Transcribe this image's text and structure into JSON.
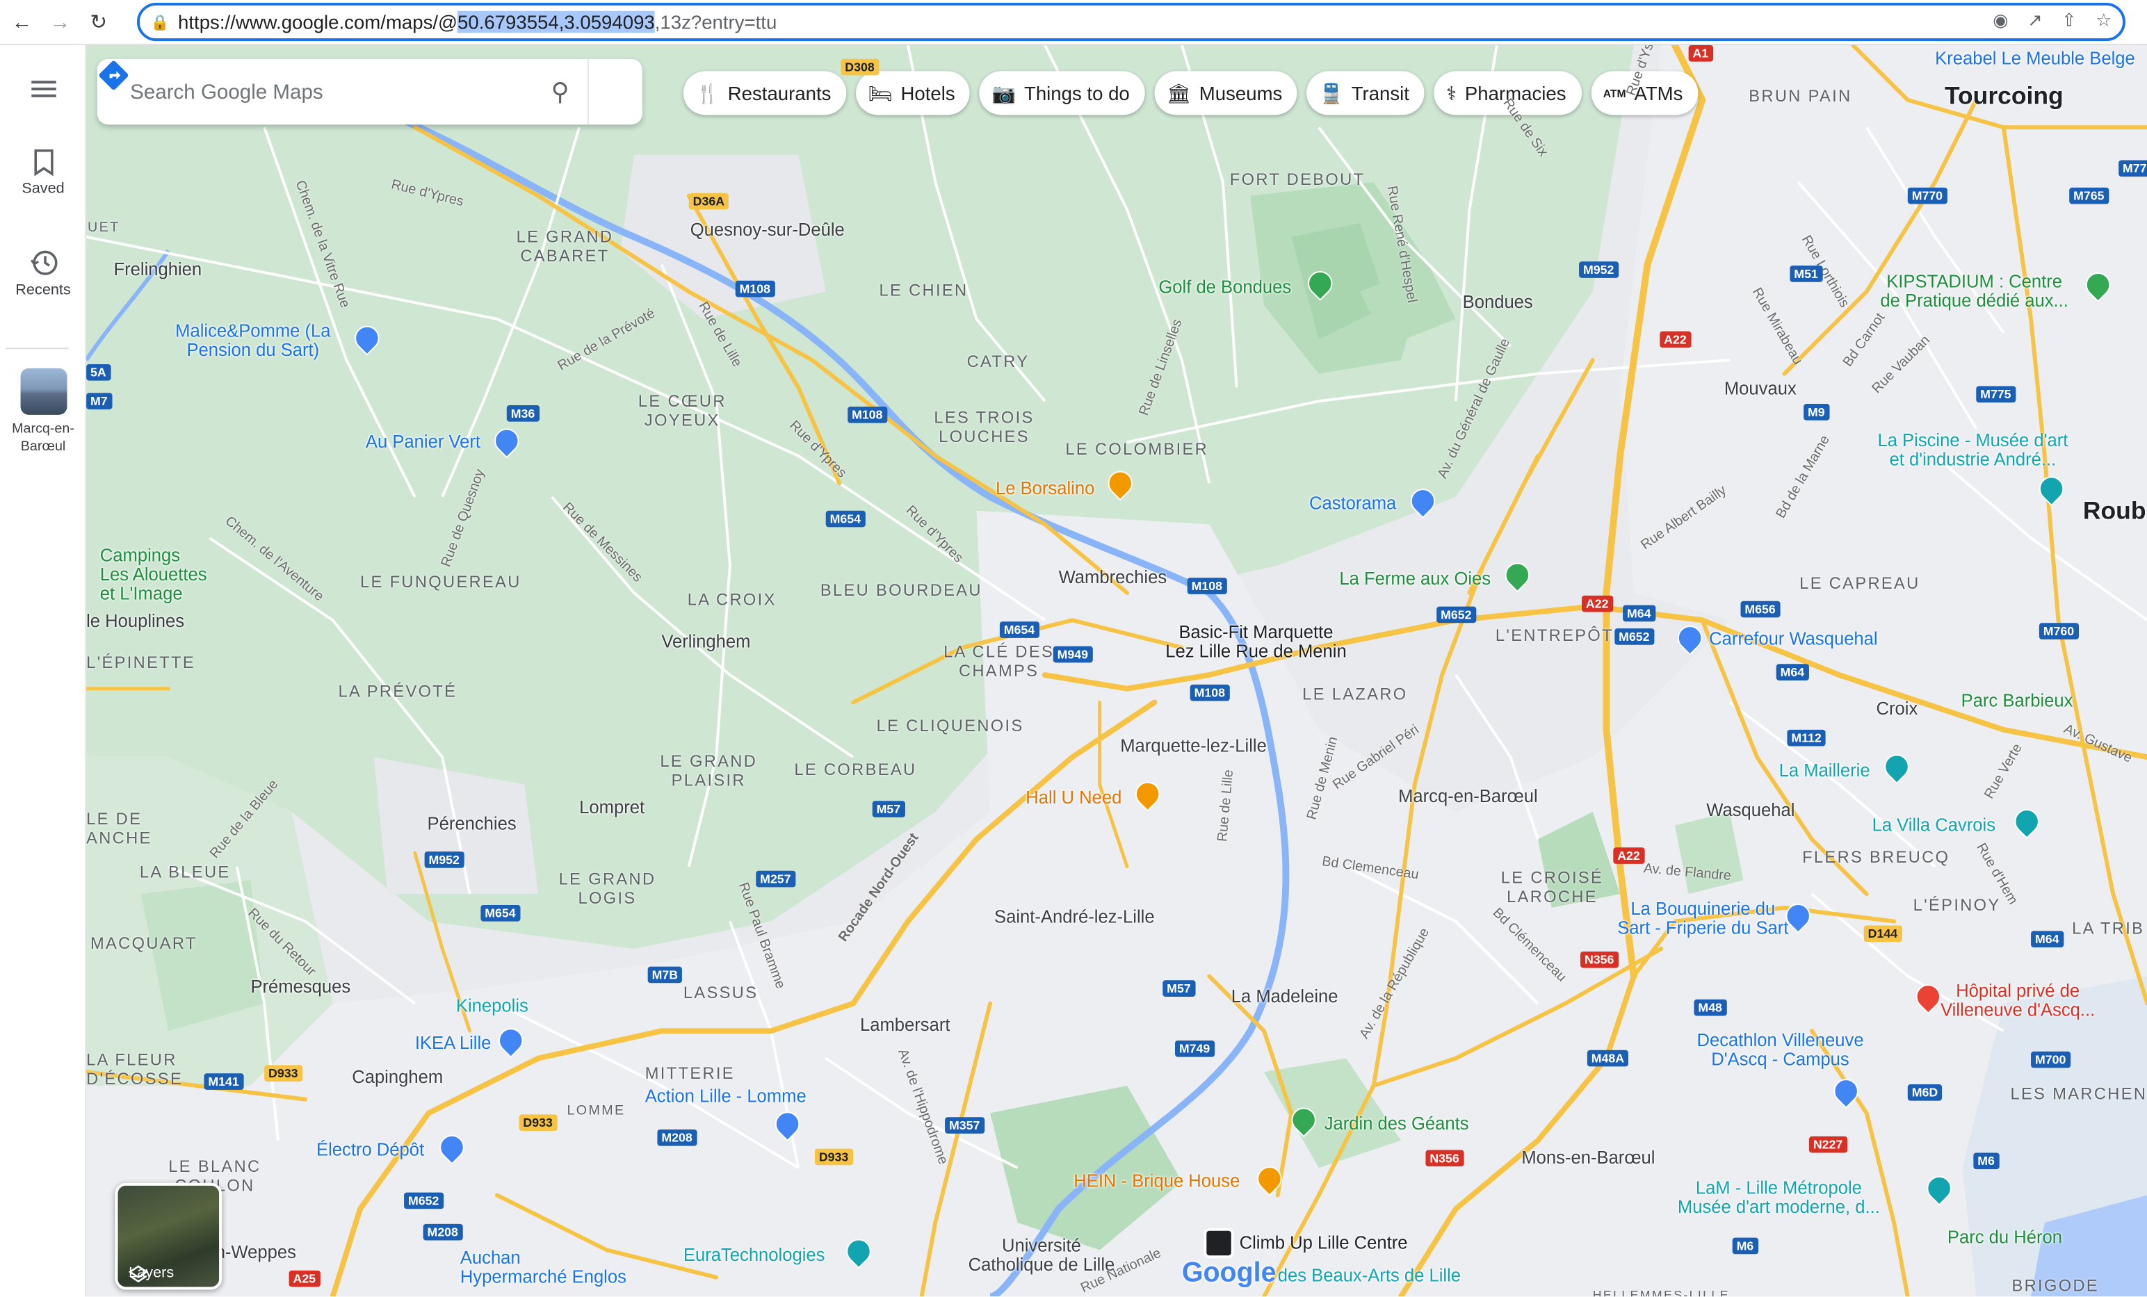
{
  "browser": {
    "url_prefix": "https://www.google.com/maps/@",
    "url_highlight": "50.6793554,3.0594093",
    "url_suffix": ",13z?entry=ttu"
  },
  "rail": {
    "menu_icon": "hamburger-icon",
    "saved_label": "Saved",
    "recents_label": "Recents",
    "recent_place_label": "Marcq-en-Barœul"
  },
  "search": {
    "placeholder": "Search Google Maps"
  },
  "chips": [
    {
      "label": "Restaurants",
      "icon": "🍴"
    },
    {
      "label": "Hotels",
      "icon": "🛏"
    },
    {
      "label": "Things to do",
      "icon": "📷"
    },
    {
      "label": "Museums",
      "icon": "🏛"
    },
    {
      "label": "Transit",
      "icon": "🚆"
    },
    {
      "label": "Pharmacies",
      "icon": "⚕"
    },
    {
      "label": "ATMs",
      "icon": "ATM"
    }
  ],
  "layers_label": "Layers",
  "google_logo": "Google",
  "map_labels": {
    "tourcoing": "Tourcoing",
    "roubaix": "Roub",
    "kreabel": "Kreabel Le Meuble Belge",
    "brun_pain": "BRUN PAIN",
    "fort_debout": "FORT DEBOUT",
    "frelinghien": "Frelinghien",
    "le_grand_cabaret_1": "LE GRAND",
    "le_grand_cabaret_2": "CABARET",
    "quesnoy": "Quesnoy-sur-Deûle",
    "le_chien": "LE CHIEN",
    "golf": "Golf de Bondues",
    "bondues": "Bondues",
    "kipstadium_1": "KIPSTADIUM : Centre",
    "kipstadium_2": "de Pratique dédié aux...",
    "malice_1": "Malice&Pomme (La",
    "malice_2": "Pension du Sart)",
    "catry": "CATRY",
    "mouvaux": "Mouvaux",
    "le_coeur_1": "LE CŒUR",
    "le_coeur_2": "JOYEUX",
    "les_trois_1": "LES TROIS",
    "les_trois_2": "LOUCHES",
    "au_panier": "Au Panier Vert",
    "le_colombier": "LE COLOMBIER",
    "la_piscine_1": "La Piscine - Musée d'art",
    "la_piscine_2": "et d'industrie André...",
    "le_borsalino": "Le Borsalino",
    "castorama": "Castorama",
    "campings_1": "Campings",
    "campings_2": "Les Alouettes",
    "campings_3": "et L'Image",
    "le_funquereau": "LE FUNQUEREAU",
    "wambrechies": "Wambrechies",
    "la_ferme": "La Ferme aux Oies",
    "le_capreau": "LE CAPREAU",
    "la_croix": "LA CROIX",
    "bleu_bourdeau": "BLEU BOURDEAU",
    "houplines": "le Houplines",
    "lepinette": "L'ÉPINETTE",
    "verlinghem": "Verlinghem",
    "basic_fit_1": "Basic-Fit Marquette",
    "basic_fit_2": "Lez Lille Rue de Menin",
    "lentrepot": "L'ENTREPÔT",
    "carrefour": "Carrefour Wasquehal",
    "la_cle_1": "LA CLÉ DES",
    "la_cle_2": "CHAMPS",
    "la_prevote": "LA PRÉVOTÉ",
    "le_lazaro": "LE LAZARO",
    "parc_barbieux": "Parc Barbieux",
    "croix": "Croix",
    "le_cliquenois": "LE CLIQUENOIS",
    "marquette": "Marquette-lez-Lille",
    "le_grand_plaisir_1": "LE GRAND",
    "le_grand_plaisir_2": "PLAISIR",
    "le_corbeau": "LE CORBEAU",
    "la_maillerie": "La Maillerie",
    "marcq": "Marcq-en-Barœul",
    "hall_u_need": "Hall U Need",
    "lompret": "Lompret",
    "wasquehal": "Wasquehal",
    "perenchies": "Pérenchies",
    "la_villa": "La Villa Cavrois",
    "le_de_anche_1": "LE DE",
    "le_de_anche_2": "ANCHE",
    "flers": "FLERS BREUCQ",
    "la_bleue": "LA BLEUE",
    "le_grand_logis_1": "LE GRAND",
    "le_grand_logis_2": "LOGIS",
    "le_croise_1": "LE CROISÉ",
    "le_croise_2": "LAROCHE",
    "la_bouquinerie_1": "La Bouquinerie du",
    "la_bouquinerie_2": "Sart - Friperie du Sart",
    "lepinoy": "L'ÉPINOY",
    "saint_andre": "Saint-André-lez-Lille",
    "la_trib": "LA TRIB",
    "macquart": "MACQUART",
    "premesques": "Prémesques",
    "lassus": "LASSUS",
    "la_madeleine": "La Madeleine",
    "hopital_1": "Hôpital privé de",
    "hopital_2": "Villeneuve d'Ascq...",
    "kinepolis": "Kinepolis",
    "lambersart": "Lambersart",
    "decathlon_1": "Decathlon Villeneuve",
    "decathlon_2": "D'Ascq - Campus",
    "ikea": "IKEA Lille",
    "la_fleur_1": "LA FLEUR",
    "la_fleur_2": "D'ÉCOSSE",
    "capinghem": "Capinghem",
    "mitterie": "MITTERIE",
    "les_marchenel": "LES MARCHENE",
    "action": "Action Lille - Lomme",
    "lomme": "LOMME",
    "jardin": "Jardin des Géants",
    "electro": "Électro Dépôt",
    "mons": "Mons-en-Barœul",
    "hein_1": "HEIN - Brique House",
    "le_blanc_1": "LE BLANC",
    "le_blanc_2": "COULON",
    "lam_1": "LaM - Lille Métropole",
    "lam_2": "Musée d'art moderne, d...",
    "parc_heron": "Parc du Héron",
    "en_weppes": "en-Weppes",
    "auchan_1": "Auchan",
    "auchan_2": "Hypermarché Englos",
    "euratech": "EuraTechnologies",
    "universite_1": "Université",
    "universite_2": "Catholique de Lille",
    "climb_up": "Climb Up Lille Centre",
    "beaux_arts": "des Beaux-Arts de Lille",
    "brigode": "BRIGODE",
    "uet": "UET",
    "hellemmes": "HELLEMMES-LILLE"
  },
  "streets": {
    "rue_dypres_1": "Rue d'Ypres",
    "rue_de_lille": "Rue de Lille",
    "rue_dypres_2": "Rue d'Ypres",
    "rue_dypres_3": "Rue d'Ypres",
    "rue_de_la_prevote": "Rue de la Prévoté",
    "chem_vitre": "Chem. de la Vitre Rue",
    "rue_quesnoy": "Rue de Quesnoy",
    "rue_messines": "Rue de Messines",
    "chem_aventure": "Chem. de l'Aventure",
    "rue_lincelles": "Rue de Linselles",
    "av_general": "Av. du Général de Gaulle",
    "rue_rene": "Rue René d'Hespel",
    "rue_mirabeau": "Rue Mirabeau",
    "bd_carnot": "Bd Carnot",
    "rue_vauban": "Rue Vauban",
    "rue_lorthiois": "Rue Lorthiois",
    "bd_marne": "Bd de la Marne",
    "rue_albert": "Rue Albert Bailly",
    "rocade": "Rocade Nord-Ouest",
    "av_hippodrome": "Av. de l'Hippodrome",
    "rue_de_menin": "Rue de Menin",
    "bd_clemenceau_1": "Bd Clemenceau",
    "bd_clemenceau_2": "Bd Clémenceau",
    "av_republique": "Av. de la République",
    "av_flandre": "Av. de Flandre",
    "rue_paul_bramme": "Rue Paul Bramme",
    "rue_du_retour": "Rue du Retour",
    "rue_de_la_bleue": "Rue de la Bleue",
    "rue_gabriel": "Rue Gabriel Péri",
    "rue_de_lille_2": "Rue de Lille",
    "rue_hem": "Rue d'Hem",
    "rue_verte": "Rue Verte",
    "av_gustave": "Av. Gustave",
    "rue_nationale": "Rue Nationale",
    "rue_six": "Rue de Six",
    "rue_deux": "Rue d'Yser"
  },
  "shields": {
    "d308": "D308",
    "d36a": "D36A",
    "m108a": "M108",
    "m108b": "M108",
    "m108c": "M108",
    "m108d": "M108",
    "m36": "M36",
    "m654a": "M654",
    "m654b": "M654",
    "m654c": "M654",
    "m949": "M949",
    "m57a": "M57",
    "m57b": "M57",
    "m257": "M257",
    "m952a": "M952",
    "m952b": "M952",
    "m7b": "M7B",
    "m749": "M749",
    "m357": "M357",
    "m208a": "M208",
    "m208b": "M208",
    "d933a": "D933",
    "d933b": "D933",
    "d933c": "D933",
    "m141": "M141",
    "m652a": "M652",
    "m652b": "M652",
    "m652c": "M652",
    "a25": "A25",
    "m770": "M770",
    "m765": "M765",
    "m51": "M51",
    "a22a": "A22",
    "a22b": "A22",
    "a22c": "A22",
    "m9": "M9",
    "m775": "M775",
    "m656": "M656",
    "m64a": "M64",
    "m64b": "M64",
    "m64c": "M64",
    "m760": "M760",
    "m112": "M112",
    "n356a": "N356",
    "n356b": "N356",
    "m48": "M48",
    "m48a": "M48A",
    "d144": "D144",
    "m700": "M700",
    "m6d": "M6D",
    "n227": "N227",
    "m6a": "M6",
    "m6b": "M6",
    "m7": "M7",
    "5a": "5A",
    "a1": "A1",
    "m77": "M77"
  }
}
